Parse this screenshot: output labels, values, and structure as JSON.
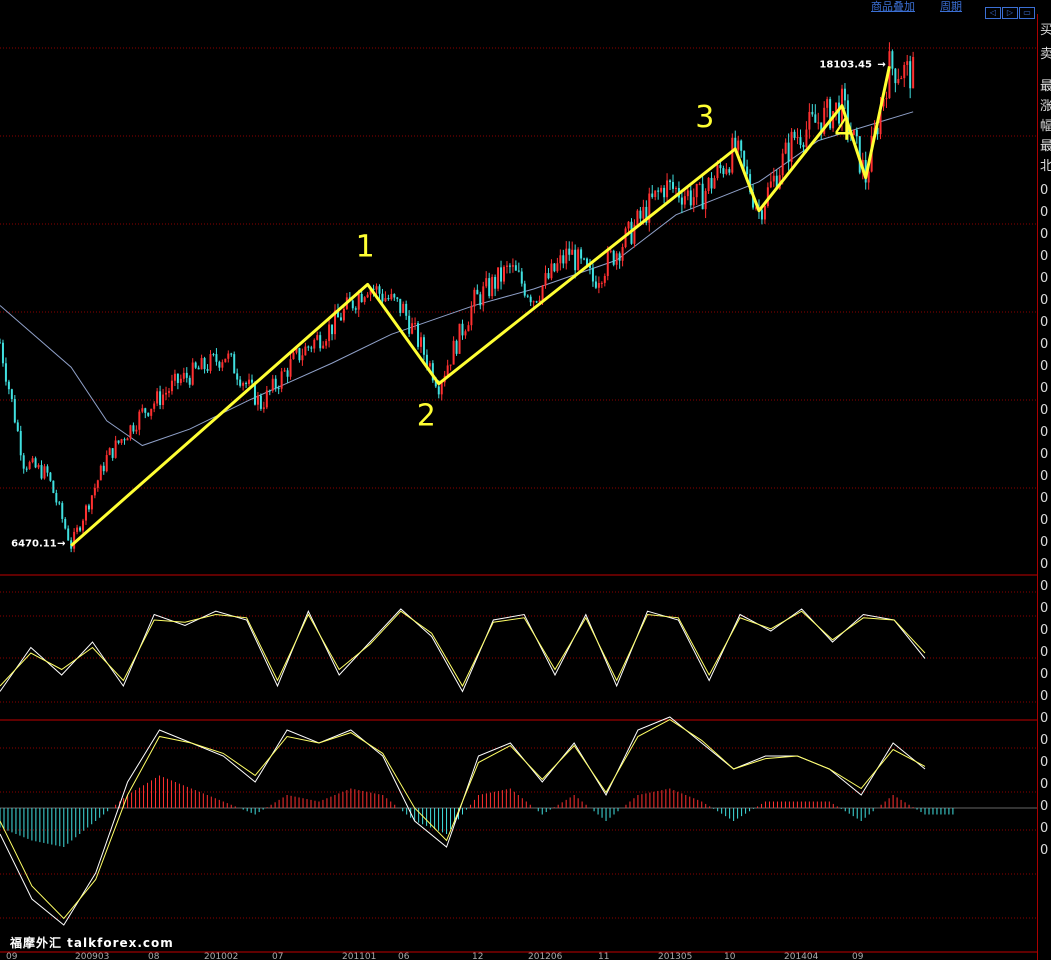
{
  "toolbar": {
    "overlay_link": "商品叠加",
    "period_link": "周期",
    "nav_left": "◁",
    "nav_right": "▷",
    "nav_grid": "▭"
  },
  "side_labels": [
    "买",
    "卖",
    "最",
    "涨",
    "幅",
    "最",
    "北",
    "0",
    "0",
    "0",
    "0",
    "0",
    "0",
    "0",
    "0",
    "0",
    "0",
    "0",
    "0",
    "0",
    "0",
    "0",
    "0",
    "0",
    "0",
    "0",
    "0",
    "0",
    "0",
    "0",
    "0",
    "0",
    "0",
    "0",
    "0",
    "0",
    "0",
    "0"
  ],
  "watermark": "福摩外汇 talkforex.com",
  "colors": {
    "background": "#000000",
    "grid": "#8b0000",
    "up_candle": "#ff3030",
    "down_candle": "#40e0e0",
    "wave_line": "#ffff33",
    "moving_average": "#8fa0c8",
    "k_line": "#ffffff",
    "d_line": "#ffff66"
  },
  "chart_data": [
    {
      "type": "line",
      "panel": "price",
      "annotations": {
        "low_label": "6470.11",
        "high_label": "18103.45",
        "wave_numbers": [
          "1",
          "2",
          "3",
          "4"
        ]
      },
      "price_range": [
        6000,
        18500
      ],
      "low": 6470.11,
      "high": 18103.45,
      "time_range": [
        "2008-09",
        "2015-03"
      ],
      "x_ticks": [
        "09",
        "200903",
        "08",
        "201002",
        "07",
        "201101",
        "06",
        "12",
        "201206",
        "11",
        "201305",
        "10",
        "201404",
        "09"
      ],
      "elliott_wave_points": {
        "x": [
          "2009-03",
          "2011-04",
          "2011-10",
          "2013-11",
          "2014-01",
          "2014-08",
          "2014-10",
          "2014-12"
        ],
        "y": [
          6470.11,
          12810,
          10400,
          16100,
          14600,
          17150,
          15400,
          18103.45
        ]
      },
      "price_path": {
        "x": [
          "2008-09",
          "2008-11",
          "2009-01",
          "2009-03",
          "2009-06",
          "2009-09",
          "2009-12",
          "2010-04",
          "2010-07",
          "2010-10",
          "2011-01",
          "2011-04",
          "2011-07",
          "2011-10",
          "2012-01",
          "2012-04",
          "2012-06",
          "2012-09",
          "2012-11",
          "2013-02",
          "2013-05",
          "2013-08",
          "2013-11",
          "2014-01",
          "2014-04",
          "2014-08",
          "2014-10",
          "2014-12",
          "2015-02"
        ],
        "y": [
          11400,
          8500,
          8200,
          6470.11,
          8600,
          9700,
          10450,
          11100,
          9900,
          11050,
          11800,
          12810,
          12200,
          10400,
          12400,
          13200,
          12500,
          13600,
          12900,
          14000,
          15200,
          14900,
          16100,
          14600,
          16400,
          17150,
          15400,
          18103.45,
          17900
        ]
      },
      "moving_average": {
        "x": [
          "2008-09",
          "2009-03",
          "2009-06",
          "2009-09",
          "2010-01",
          "2010-06",
          "2011-01",
          "2011-06",
          "2012-01",
          "2012-06",
          "2013-01",
          "2013-06",
          "2014-01",
          "2014-06",
          "2015-02"
        ],
        "y": [
          12300,
          10800,
          9500,
          8900,
          9300,
          10000,
          10900,
          11600,
          12300,
          12700,
          13400,
          14500,
          15300,
          16300,
          17000
        ]
      }
    },
    {
      "type": "line",
      "panel": "oscillator_kd",
      "y_range": [
        0,
        100
      ],
      "series": [
        {
          "values": [
            15,
            55,
            30,
            60,
            20,
            85,
            75,
            88,
            80,
            20,
            88,
            30,
            60,
            90,
            65,
            15,
            80,
            85,
            30,
            85,
            20,
            88,
            80,
            25,
            85,
            70,
            90,
            60,
            85,
            80,
            45
          ]
        },
        {
          "values": [
            20,
            50,
            35,
            55,
            25,
            80,
            78,
            85,
            82,
            25,
            85,
            35,
            58,
            88,
            68,
            20,
            78,
            82,
            35,
            82,
            25,
            85,
            82,
            30,
            82,
            72,
            88,
            62,
            82,
            80,
            50
          ]
        }
      ]
    },
    {
      "type": "bar",
      "panel": "macd",
      "y_range": [
        -1,
        1
      ],
      "histogram": [
        -0.3,
        -0.5,
        -0.6,
        -0.2,
        0.2,
        0.5,
        0.3,
        0.1,
        -0.1,
        0.2,
        0.1,
        0.3,
        0.2,
        -0.2,
        -0.4,
        0.2,
        0.3,
        -0.1,
        0.2,
        -0.2,
        0.2,
        0.3,
        0.1,
        -0.2,
        0.1,
        0.1,
        0.1,
        -0.2,
        0.2,
        -0.1
      ],
      "series": [
        {
          "values": [
            -0.2,
            -0.7,
            -0.9,
            -0.5,
            0.2,
            0.6,
            0.5,
            0.4,
            0.2,
            0.6,
            0.5,
            0.6,
            0.4,
            -0.1,
            -0.3,
            0.4,
            0.5,
            0.2,
            0.5,
            0.1,
            0.6,
            0.7,
            0.5,
            0.3,
            0.4,
            0.4,
            0.3,
            0.1,
            0.5,
            0.3
          ]
        },
        {
          "values": [
            -0.1,
            -0.6,
            -0.85,
            -0.55,
            0.1,
            0.55,
            0.5,
            0.42,
            0.25,
            0.55,
            0.5,
            0.58,
            0.42,
            0.0,
            -0.25,
            0.35,
            0.48,
            0.22,
            0.48,
            0.12,
            0.55,
            0.68,
            0.52,
            0.3,
            0.38,
            0.4,
            0.3,
            0.15,
            0.45,
            0.32
          ]
        }
      ]
    }
  ]
}
